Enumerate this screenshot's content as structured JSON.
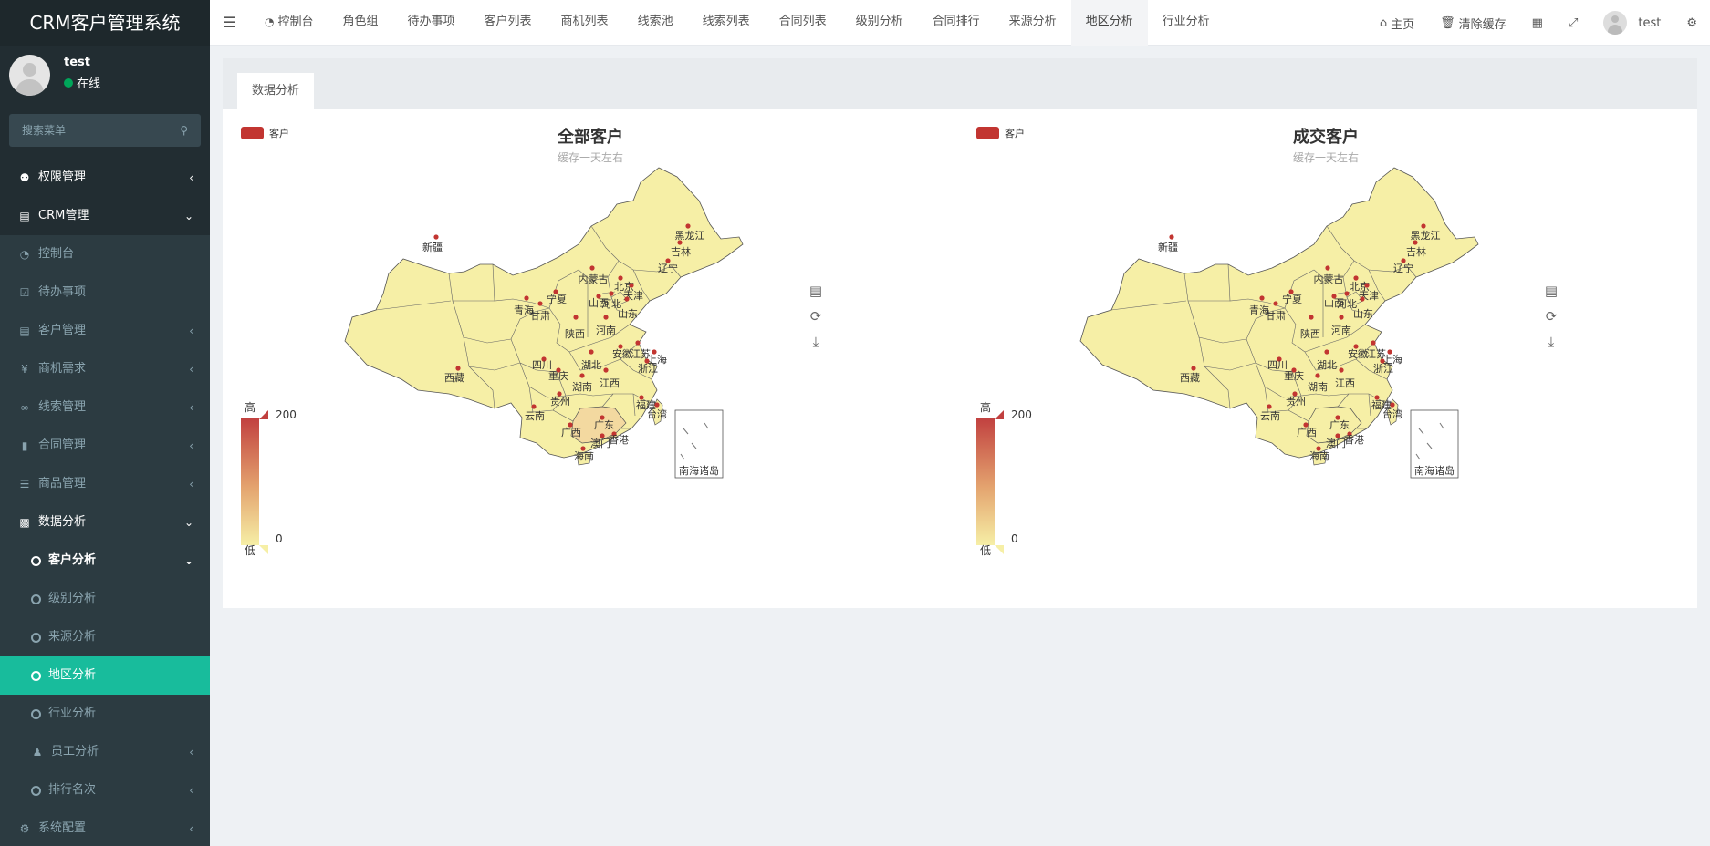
{
  "app": {
    "title": "CRM客户管理系统"
  },
  "user": {
    "name": "test",
    "status": "在线"
  },
  "sidebar": {
    "search_placeholder": "搜索菜单",
    "items": [
      {
        "label": "权限管理",
        "icon": "users-icon"
      },
      {
        "label": "CRM管理",
        "icon": "id-card-icon"
      },
      {
        "label": "控制台",
        "icon": "dashboard-icon"
      },
      {
        "label": "待办事项",
        "icon": "calendar-check-icon"
      },
      {
        "label": "客户管理",
        "icon": "id-card-icon"
      },
      {
        "label": "商机需求",
        "icon": "yen-icon"
      },
      {
        "label": "线索管理",
        "icon": "link-icon"
      },
      {
        "label": "合同管理",
        "icon": "bookmark-icon"
      },
      {
        "label": "商品管理",
        "icon": "list-icon"
      },
      {
        "label": "数据分析",
        "icon": "bar-chart-icon"
      },
      {
        "label": "客户分析",
        "icon": "circle-icon"
      },
      {
        "label": "级别分析",
        "icon": "circle-icon"
      },
      {
        "label": "来源分析",
        "icon": "circle-icon"
      },
      {
        "label": "地区分析",
        "icon": "circle-icon"
      },
      {
        "label": "行业分析",
        "icon": "circle-icon"
      },
      {
        "label": "员工分析",
        "icon": "user-icon"
      },
      {
        "label": "排行名次",
        "icon": "circle-icon"
      },
      {
        "label": "系统配置",
        "icon": "cogs-icon"
      }
    ]
  },
  "navbar": {
    "tabs": [
      "控制台",
      "角色组",
      "待办事项",
      "客户列表",
      "商机列表",
      "线索池",
      "线索列表",
      "合同列表",
      "级别分析",
      "合同排行",
      "来源分析",
      "地区分析",
      "行业分析"
    ],
    "active_tab": "地区分析",
    "home": "主页",
    "clear_cache": "清除缓存",
    "user": "test"
  },
  "panel": {
    "tab_label": "数据分析"
  },
  "charts": [
    {
      "title": "全部客户",
      "subtitle": "缓存一天左右",
      "legend": "客户"
    },
    {
      "title": "成交客户",
      "subtitle": "缓存一天左右",
      "legend": "客户"
    }
  ],
  "chart_data": [
    {
      "type": "map",
      "title": "全部客户",
      "subtitle": "缓存一天左右",
      "series": [
        {
          "name": "客户"
        }
      ],
      "visualMap": {
        "min": 0,
        "max": 200,
        "text": [
          "高",
          "低"
        ],
        "colors": [
          "#c1403f",
          "#f6efa6"
        ]
      },
      "regions": [
        "新疆",
        "西藏",
        "青海",
        "甘肃",
        "宁夏",
        "内蒙古",
        "陕西",
        "山西",
        "北京",
        "天津",
        "河北",
        "山东",
        "河南",
        "黑龙江",
        "吉林",
        "辽宁",
        "四川",
        "重庆",
        "湖北",
        "安徽",
        "江苏",
        "上海",
        "浙江",
        "湖南",
        "江西",
        "贵州",
        "云南",
        "广西",
        "广东",
        "福建",
        "台湾",
        "香港",
        "澳门",
        "海南",
        "南海诸岛"
      ],
      "highlighted": [
        "广东"
      ]
    },
    {
      "type": "map",
      "title": "成交客户",
      "subtitle": "缓存一天左右",
      "series": [
        {
          "name": "客户"
        }
      ],
      "visualMap": {
        "min": 0,
        "max": 200,
        "text": [
          "高",
          "低"
        ],
        "colors": [
          "#c1403f",
          "#f6efa6"
        ]
      },
      "regions": [
        "新疆",
        "西藏",
        "青海",
        "甘肃",
        "宁夏",
        "内蒙古",
        "陕西",
        "山西",
        "北京",
        "天津",
        "河北",
        "山东",
        "河南",
        "黑龙江",
        "吉林",
        "辽宁",
        "四川",
        "重庆",
        "湖北",
        "安徽",
        "江苏",
        "上海",
        "浙江",
        "湖南",
        "江西",
        "贵州",
        "云南",
        "广西",
        "广东",
        "福建",
        "台湾",
        "香港",
        "澳门",
        "海南",
        "南海诸岛"
      ],
      "highlighted": []
    }
  ]
}
